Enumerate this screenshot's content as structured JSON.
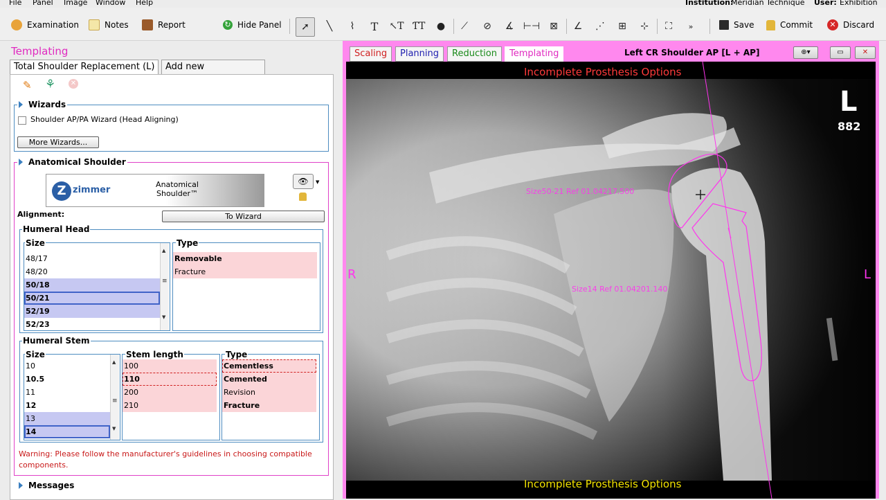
{
  "menu": {
    "items": [
      "File",
      "Panel",
      "Image",
      "Window",
      "Help"
    ],
    "institution_label": "Institution:",
    "institution_value": "Meridian Technique",
    "user_label": "User:",
    "user_value": "Exhibition"
  },
  "toolbar": {
    "examination": "Examination",
    "notes": "Notes",
    "report": "Report",
    "hide_panel": "Hide Panel",
    "save": "Save",
    "commit": "Commit",
    "discard": "Discard",
    "more": "»"
  },
  "left": {
    "title": "Templating",
    "tabs": [
      "Total Shoulder Replacement (L)",
      "Add new procedure..."
    ],
    "wizards": {
      "header": "Wizards",
      "checkbox_label": "Shoulder AP/PA Wizard (Head Aligning)",
      "more_button": "More Wizards..."
    },
    "anatomical": {
      "header": "Anatomical Shoulder",
      "brand": "zimmer",
      "product_line1": "Anatomical",
      "product_line2": "Shoulder™",
      "alignment_label": "Alignment:",
      "to_wizard": "To Wizard"
    },
    "humeral_head": {
      "label": "Humeral Head",
      "size_label": "Size",
      "type_label": "Type",
      "sizes": [
        "48/17",
        "48/20",
        "50/18",
        "50/21",
        "52/19",
        "52/23"
      ],
      "types": [
        "Removable",
        "Fracture"
      ]
    },
    "humeral_stem": {
      "label": "Humeral Stem",
      "size_label": "Size",
      "length_label": "Stem length",
      "type_label": "Type",
      "sizes": [
        "10",
        "10.5",
        "11",
        "12",
        "13",
        "14"
      ],
      "lengths": [
        "100",
        "110",
        "200",
        "210"
      ],
      "types": [
        "Cementless",
        "Cemented",
        "Revision",
        "Fracture"
      ]
    },
    "warning": "Warning: Please follow the manufacturer's guidelines in choosing compatible components.",
    "messages": "Messages"
  },
  "right": {
    "tabs": [
      "Scaling",
      "Planning",
      "Reduction",
      "Templating"
    ],
    "view_title": "Left CR Shoulder AP  [L + AP]",
    "top_message": "Incomplete Prosthesis Options",
    "bottom_message": "Incomplete Prosthesis Options",
    "orient_left": "R",
    "orient_right": "L",
    "corner_letter": "L",
    "corner_number": "882",
    "head_label": "Size50-21 Ref 01.04217.500",
    "stem_label": "Size14 Ref 01.04201.140"
  },
  "colors": {
    "accent_pink": "#e02ac0",
    "viewer_border": "#ff88ee",
    "overlay_red": "#ff3a3a",
    "overlay_yellow": "#f2e200",
    "template_magenta": "#ff33ee"
  }
}
